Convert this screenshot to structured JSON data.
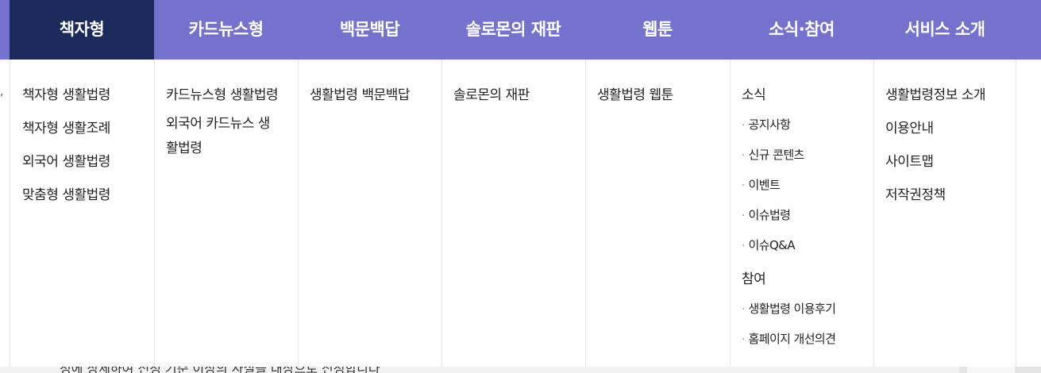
{
  "nav": {
    "items": [
      {
        "label": "책자형"
      },
      {
        "label": "카드뉴스형"
      },
      {
        "label": "백문백답"
      },
      {
        "label": "솔로몬의 재판"
      },
      {
        "label": "웹툰"
      },
      {
        "label": "소식·참여"
      },
      {
        "label": "서비스 소개"
      }
    ],
    "active_index": 0
  },
  "menu": {
    "book": [
      "책자형 생활법령",
      "책자형 생활조례",
      "외국어 생활법령",
      "맞춤형 생활법령"
    ],
    "card": [
      "카드뉴스형 생활법령",
      "외국어 카드뉴스 생활법령"
    ],
    "qa": [
      "생활법령 백문백답"
    ],
    "solomon": [
      "솔로몬의 재판"
    ],
    "webtoon": [
      "생활법령 웹툰"
    ],
    "news": {
      "heading": "소식",
      "items": [
        "공지사항",
        "신규 콘텐츠",
        "이벤트",
        "이슈법령",
        "이슈Q&A"
      ]
    },
    "participate": {
      "heading": "참여",
      "items": [
        "생활법령 이용후기",
        "홈페이지 개선의견"
      ]
    },
    "service": [
      "생활법령정보 소개",
      "이용안내",
      "사이트맵",
      "저작권정책"
    ]
  },
  "colors": {
    "nav_bg": "#7472cc",
    "nav_active_bg": "#1c2a5b",
    "nav_text": "#ffffff"
  },
  "edge_mark": ",",
  "underlying_text": "청에 상세하여 신청 기준 이상의 사실을 대상으로 신청합니다"
}
